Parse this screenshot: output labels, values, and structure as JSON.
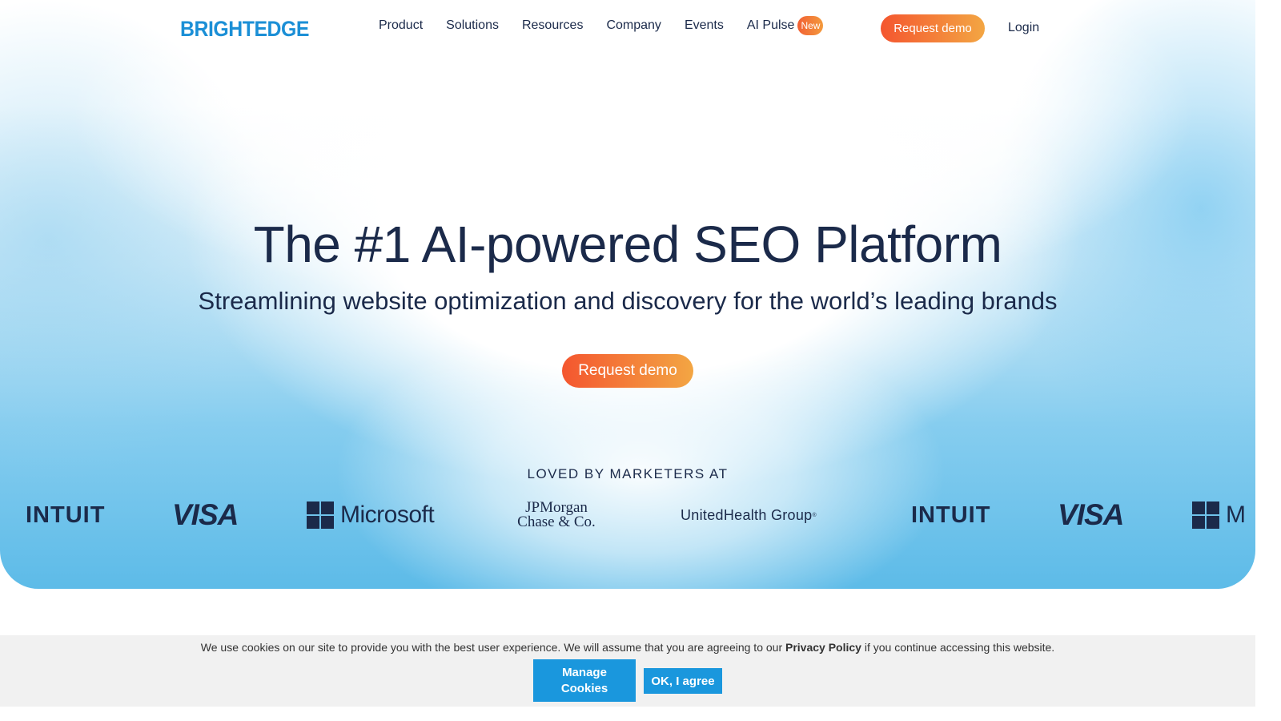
{
  "header": {
    "logo": "BRIGHTEDGE",
    "nav": [
      "Product",
      "Solutions",
      "Resources",
      "Company",
      "Events"
    ],
    "ai_pulse": "AI Pulse",
    "new_badge": "New",
    "request_demo": "Request demo",
    "login": "Login"
  },
  "hero": {
    "title": "The #1 AI-powered SEO Platform",
    "subtitle": "Streamlining website optimization and discovery for the world’s leading brands",
    "cta": "Request demo",
    "loved_by": "LOVED BY MARKETERS AT",
    "logos": {
      "intuit": "INTUIT",
      "visa": "VISA",
      "microsoft": "Microsoft",
      "jpmorgan_line1": "JPMorgan",
      "jpmorgan_line2": "Chase & Co.",
      "unitedhealth": "UnitedHealth Group",
      "intuit_2": "INTUIT",
      "visa_2": "VISA",
      "microsoft_partial": "M"
    }
  },
  "cookie_bar": {
    "text_before": "We use cookies on our site to provide you with the best user experience. We will assume that you are agreeing to our ",
    "policy_link": "Privacy Policy",
    "text_after": " if you continue accessing this website.",
    "manage_line1": "Manage",
    "manage_line2": "Cookies",
    "ok": "OK, I agree"
  },
  "colors": {
    "brand_blue": "#1b8fd6",
    "navy_text": "#1b2a4a",
    "cta_gradient_start": "#f4562f",
    "cta_gradient_end": "#f3a643",
    "cookie_button": "#1a97dd"
  }
}
